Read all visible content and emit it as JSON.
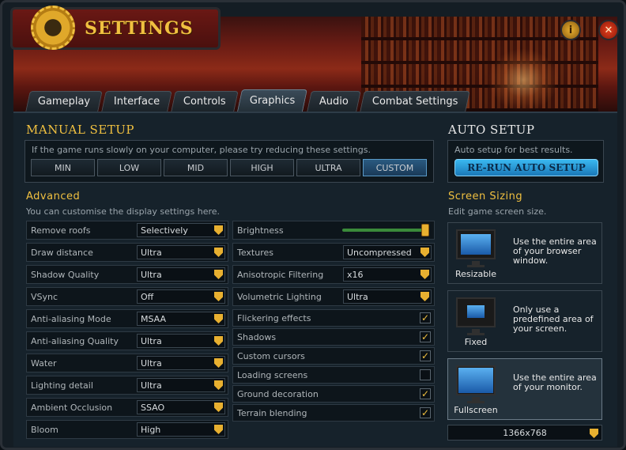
{
  "window": {
    "title": "SETTINGS"
  },
  "tabs": [
    "Gameplay",
    "Interface",
    "Controls",
    "Graphics",
    "Audio",
    "Combat Settings"
  ],
  "active_tab": "Graphics",
  "manual_setup": {
    "title": "MANUAL SETUP",
    "hint": "If the game runs slowly on your computer, please try reducing these settings.",
    "presets": [
      "MIN",
      "LOW",
      "MID",
      "HIGH",
      "ULTRA",
      "CUSTOM"
    ],
    "active_preset": "CUSTOM"
  },
  "auto_setup": {
    "title": "AUTO SETUP",
    "hint": "Auto setup for best results.",
    "button": "RE-RUN AUTO SETUP"
  },
  "advanced": {
    "title": "Advanced",
    "hint": "You can customise the display settings here."
  },
  "left_settings": [
    {
      "label": "Remove roofs",
      "value": "Selectively"
    },
    {
      "label": "Draw distance",
      "value": "Ultra"
    },
    {
      "label": "Shadow Quality",
      "value": "Ultra"
    },
    {
      "label": "VSync",
      "value": "Off"
    },
    {
      "label": "Anti-aliasing Mode",
      "value": "MSAA"
    },
    {
      "label": "Anti-aliasing Quality",
      "value": "Ultra"
    },
    {
      "label": "Water",
      "value": "Ultra"
    },
    {
      "label": "Lighting detail",
      "value": "Ultra"
    },
    {
      "label": "Ambient Occlusion",
      "value": "SSAO"
    },
    {
      "label": "Bloom",
      "value": "High"
    }
  ],
  "brightness": {
    "label": "Brightness",
    "level": 1.0
  },
  "right_dropdowns": [
    {
      "label": "Textures",
      "value": "Uncompressed"
    },
    {
      "label": "Anisotropic Filtering",
      "value": "x16"
    },
    {
      "label": "Volumetric Lighting",
      "value": "Ultra"
    }
  ],
  "right_checks": [
    {
      "label": "Flickering effects",
      "checked": true
    },
    {
      "label": "Shadows",
      "checked": true
    },
    {
      "label": "Custom cursors",
      "checked": true
    },
    {
      "label": "Loading screens",
      "checked": false
    },
    {
      "label": "Ground decoration",
      "checked": true
    },
    {
      "label": "Terrain blending",
      "checked": true
    }
  ],
  "screen_sizing": {
    "title": "Screen Sizing",
    "hint": "Edit game screen size.",
    "options": [
      {
        "label": "Resizable",
        "desc": "Use the entire area of your browser window."
      },
      {
        "label": "Fixed",
        "desc": "Only use a predefined area of your screen."
      },
      {
        "label": "Fullscreen",
        "desc": "Use the entire area of your monitor."
      }
    ],
    "selected": "Fullscreen",
    "resolution": "1366x768"
  },
  "colors": {
    "gold": "#f0c040",
    "accent_blue": "#3ab8f0",
    "panel": "#16222b"
  },
  "icons": {
    "check": "✓",
    "info": "i",
    "close": "✕"
  }
}
